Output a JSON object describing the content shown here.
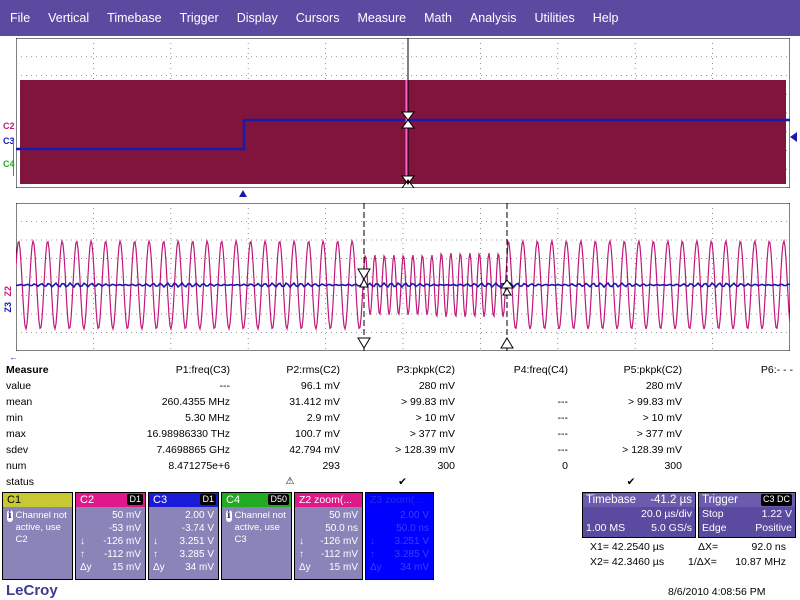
{
  "menu": [
    "File",
    "Vertical",
    "Timebase",
    "Trigger",
    "Display",
    "Cursors",
    "Measure",
    "Math",
    "Analysis",
    "Utilities",
    "Help"
  ],
  "upper_labels": {
    "c2": "C2",
    "c3": "C3",
    "c4": "C4"
  },
  "lower_labels": {
    "z2": "Z2",
    "z3": "Z3"
  },
  "colors": {
    "c2": "#c0187a",
    "c3": "#1a1aaa",
    "c4": "#22aa22",
    "c1": "#c8c832",
    "menu": "#5a4aa0",
    "z3": "#0000ff"
  },
  "measure": {
    "headers": [
      "Measure",
      "P1:freq(C3)",
      "P2:rms(C2)",
      "P3:pkpk(C2)",
      "P4:freq(C4)",
      "P5:pkpk(C2)",
      "P6:- - -"
    ],
    "rows": [
      [
        "value",
        "---",
        "96.1 mV",
        "280 mV",
        "",
        "280 mV",
        ""
      ],
      [
        "mean",
        "260.4355 MHz",
        "31.412 mV",
        "> 99.83 mV",
        "---",
        "> 99.83 mV",
        ""
      ],
      [
        "min",
        "5.30 MHz",
        "2.9 mV",
        "> 10 mV",
        "---",
        "> 10 mV",
        ""
      ],
      [
        "max",
        "16.98986330 THz",
        "100.7 mV",
        "> 377 mV",
        "---",
        "> 377 mV",
        ""
      ],
      [
        "sdev",
        "7.4698865 GHz",
        "42.794 mV",
        "> 128.39 mV",
        "---",
        "> 128.39 mV",
        ""
      ],
      [
        "num",
        "8.471275e+6",
        "293",
        "300",
        "0",
        "300",
        ""
      ],
      [
        "status",
        "",
        "⚠",
        "✔",
        "",
        "✔",
        ""
      ]
    ]
  },
  "channels": {
    "c1": {
      "name": "C1",
      "info": "Channel not active, use C2"
    },
    "c2": {
      "name": "C2",
      "badge": "D1",
      "lines": [
        [
          "",
          "50 mV"
        ],
        [
          "",
          "-53 mV"
        ],
        [
          "↓",
          "-126 mV"
        ],
        [
          "↑",
          "-112 mV"
        ],
        [
          "Δy",
          "15 mV"
        ]
      ]
    },
    "c3": {
      "name": "C3",
      "badge": "D1",
      "lines": [
        [
          "",
          "2.00 V"
        ],
        [
          "",
          "-3.74 V"
        ],
        [
          "↓",
          "3.251 V"
        ],
        [
          "↑",
          "3.285 V"
        ],
        [
          "Δy",
          "34 mV"
        ]
      ]
    },
    "c4": {
      "name": "C4",
      "badge": "D50",
      "info": "Channel not active, use C3"
    },
    "z2": {
      "name": "Z2 zoom(...",
      "lines": [
        [
          "",
          "50 mV"
        ],
        [
          "",
          "50.0 ns"
        ],
        [
          "↓",
          "-126 mV"
        ],
        [
          "↑",
          "-112 mV"
        ],
        [
          "Δy",
          "15 mV"
        ]
      ]
    },
    "z3": {
      "name": "Z3 zoom(...",
      "lines": [
        [
          "",
          "2.00 V"
        ],
        [
          "",
          "50.0 ns"
        ],
        [
          "↓",
          "3.251 V"
        ],
        [
          "↑",
          "3.285 V"
        ],
        [
          "Δy",
          "34 mV"
        ]
      ]
    }
  },
  "timebase": {
    "label": "Timebase",
    "offset": "-41.2 µs",
    "div": "20.0 µs/div",
    "samples": "1.00 MS",
    "rate": "5.0 GS/s"
  },
  "trigger": {
    "label": "Trigger",
    "badge": "C3 DC",
    "mode": "Stop",
    "level": "1.22 V",
    "coupling": "Edge",
    "slope": "Positive"
  },
  "cursors": {
    "x1": "X1= 42.2540 µs",
    "dx": "ΔX=",
    "dx_val": "92.0 ns",
    "x2": "X2= 42.3460 µs",
    "inv": "1/ΔX=",
    "inv_val": "10.87 MHz"
  },
  "logo": "LeCroy",
  "timestamp": "8/6/2010 4:08:56 PM"
}
